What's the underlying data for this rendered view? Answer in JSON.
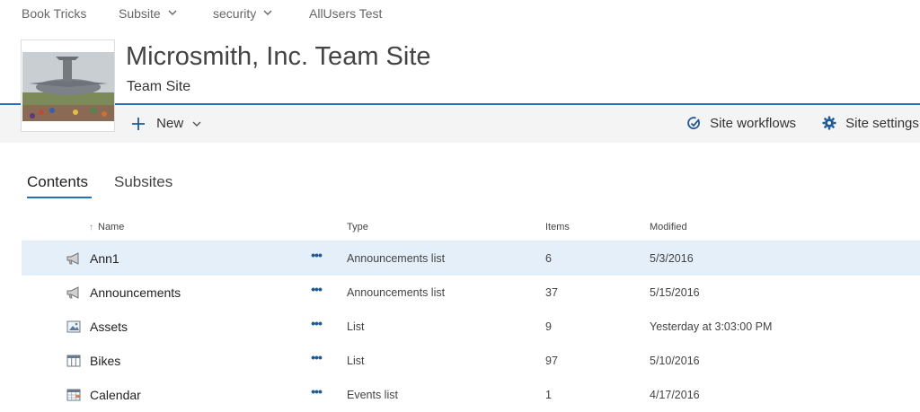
{
  "topnav": {
    "items": [
      {
        "label": "Book Tricks",
        "has_dropdown": false
      },
      {
        "label": "Subsite",
        "has_dropdown": true
      },
      {
        "label": "security",
        "has_dropdown": true
      },
      {
        "label": "AllUsers Test",
        "has_dropdown": false
      }
    ]
  },
  "header": {
    "title": "Microsmith, Inc. Team Site",
    "subtitle": "Team Site",
    "logo_icon": "site-logo-airplane-photo"
  },
  "commandbar": {
    "new_label": "New",
    "workflows_label": "Site workflows",
    "settings_label": "Site settings"
  },
  "tabs": [
    {
      "label": "Contents",
      "active": true
    },
    {
      "label": "Subsites",
      "active": false
    }
  ],
  "list": {
    "columns": {
      "name": "Name",
      "type": "Type",
      "items": "Items",
      "modified": "Modified"
    },
    "sort_icon": "↑",
    "rows": [
      {
        "icon": "announcement-icon",
        "name": "Ann1",
        "type": "Announcements list",
        "items": "6",
        "modified": "5/3/2016",
        "selected": true
      },
      {
        "icon": "announcement-icon",
        "name": "Announcements",
        "type": "Announcements list",
        "items": "37",
        "modified": "5/15/2016",
        "selected": false
      },
      {
        "icon": "image-list-icon",
        "name": "Assets",
        "type": "List",
        "items": "9",
        "modified": "Yesterday at 3:03:00 PM",
        "selected": false
      },
      {
        "icon": "table-list-icon",
        "name": "Bikes",
        "type": "List",
        "items": "97",
        "modified": "5/10/2016",
        "selected": false
      },
      {
        "icon": "calendar-icon",
        "name": "Calendar",
        "type": "Events list",
        "items": "1",
        "modified": "4/17/2016",
        "selected": false
      }
    ],
    "more_icon": "•••"
  },
  "colors": {
    "accent": "#1e73be",
    "rule": "#2a6fb5",
    "cmdbar_bg": "#f4f4f4",
    "selected_row_bg": "#e4eff9"
  }
}
